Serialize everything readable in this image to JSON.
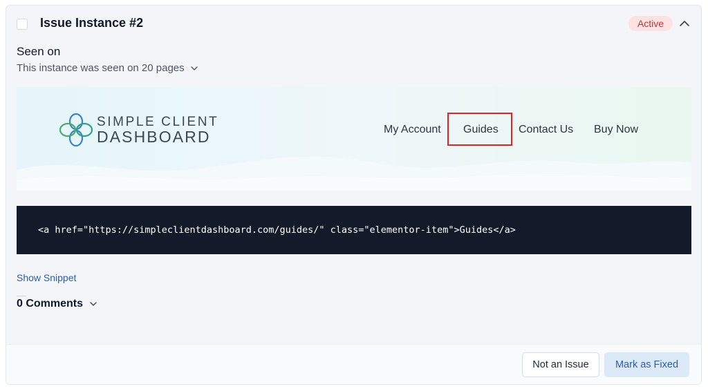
{
  "issue": {
    "title": "Issue Instance #2",
    "status": "Active"
  },
  "seen_on": {
    "label": "Seen on",
    "description": "This instance was seen on 20 pages"
  },
  "preview": {
    "logo_line1": "SIMPLE CLIENT",
    "logo_line2": "DASHBOARD",
    "nav": [
      "My Account",
      "Guides",
      "Contact Us",
      "Buy Now"
    ],
    "highlighted_nav": "Guides"
  },
  "code_snippet": "<a href=\"https://simpleclientdashboard.com/guides/\" class=\"elementor-item\">Guides</a>",
  "show_snippet_label": "Show Snippet",
  "comments_label": "0 Comments",
  "footer": {
    "not_issue_label": "Not an Issue",
    "mark_fixed_label": "Mark as Fixed"
  },
  "colors": {
    "badge_bg": "#fde2e2",
    "badge_text": "#b33a3a",
    "highlight_border": "#e02424",
    "code_bg": "#141a29",
    "link": "#2f5d9f",
    "primary_button_bg": "#dce9f8"
  },
  "icons": {
    "collapse": "chevron-up-icon",
    "expand": "chevron-down-icon",
    "logo": "interlocking-rings-logo"
  }
}
